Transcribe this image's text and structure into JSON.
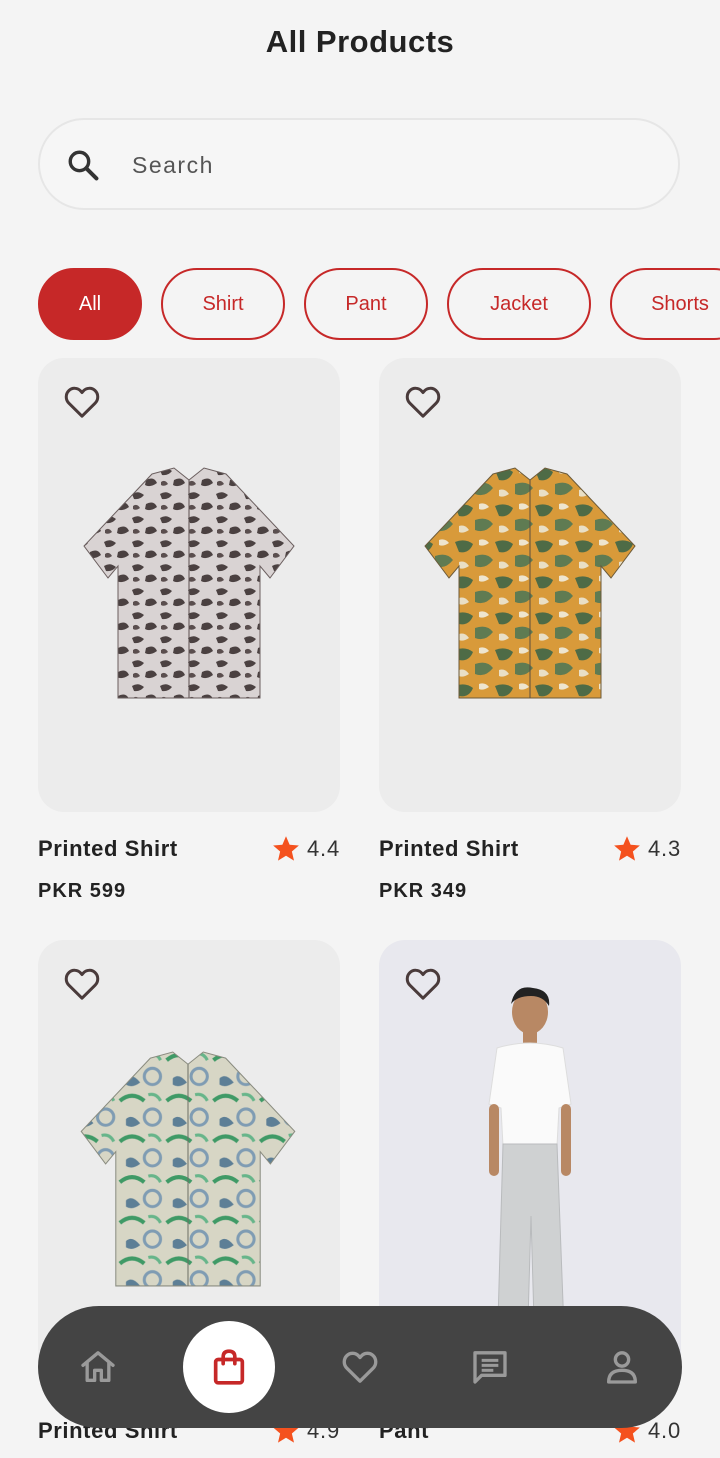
{
  "page": {
    "title": "All Products"
  },
  "search": {
    "placeholder": "Search"
  },
  "categories": [
    {
      "label": "All",
      "active": true
    },
    {
      "label": "Shirt",
      "active": false
    },
    {
      "label": "Pant",
      "active": false
    },
    {
      "label": "Jacket",
      "active": false
    },
    {
      "label": "Shorts",
      "active": false
    }
  ],
  "products": [
    {
      "name": "Printed Shirt",
      "rating": "4.4",
      "price": "PKR 599"
    },
    {
      "name": "Printed Shirt",
      "rating": "4.3",
      "price": "PKR 349"
    },
    {
      "name": "Printed Shirt",
      "rating": "4.9",
      "price": ""
    },
    {
      "name": "Pant",
      "rating": "4.0",
      "price": ""
    }
  ],
  "bottom_nav": {
    "items": [
      "home-icon",
      "shopping-bag-icon",
      "heart-icon",
      "chat-icon",
      "profile-icon"
    ],
    "active": "shopping-bag-icon"
  },
  "colors": {
    "accent": "#c62828",
    "star": "#f4511e",
    "navbar": "#444444",
    "background": "#f4f4f4"
  }
}
